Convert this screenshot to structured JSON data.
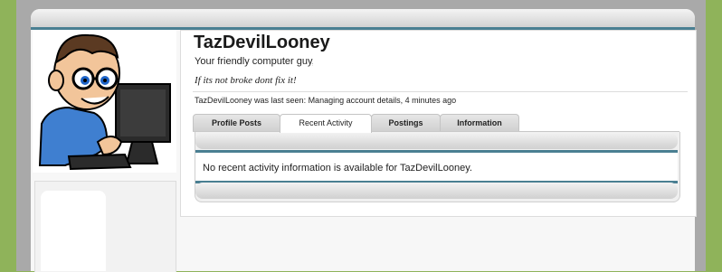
{
  "profile": {
    "username": "TazDevilLooney",
    "tagline": "Your friendly computer guy, I",
    "signature": "If its not broke dont fix it!",
    "last_seen": "TazDevilLooney was last seen: Managing account details, 4 minutes ago",
    "avatar": "cartoon-computer-guy-avatar"
  },
  "tabs": [
    {
      "label": "Profile Posts",
      "active": false
    },
    {
      "label": "Recent Activity",
      "active": true
    },
    {
      "label": "Postings",
      "active": false
    },
    {
      "label": "Information",
      "active": false
    }
  ],
  "panel": {
    "message": "No recent activity information is available for TazDevilLooney."
  },
  "colors": {
    "background": "#8fb35a",
    "accent": "#4a7f92",
    "frame": "#a9a9a9"
  }
}
